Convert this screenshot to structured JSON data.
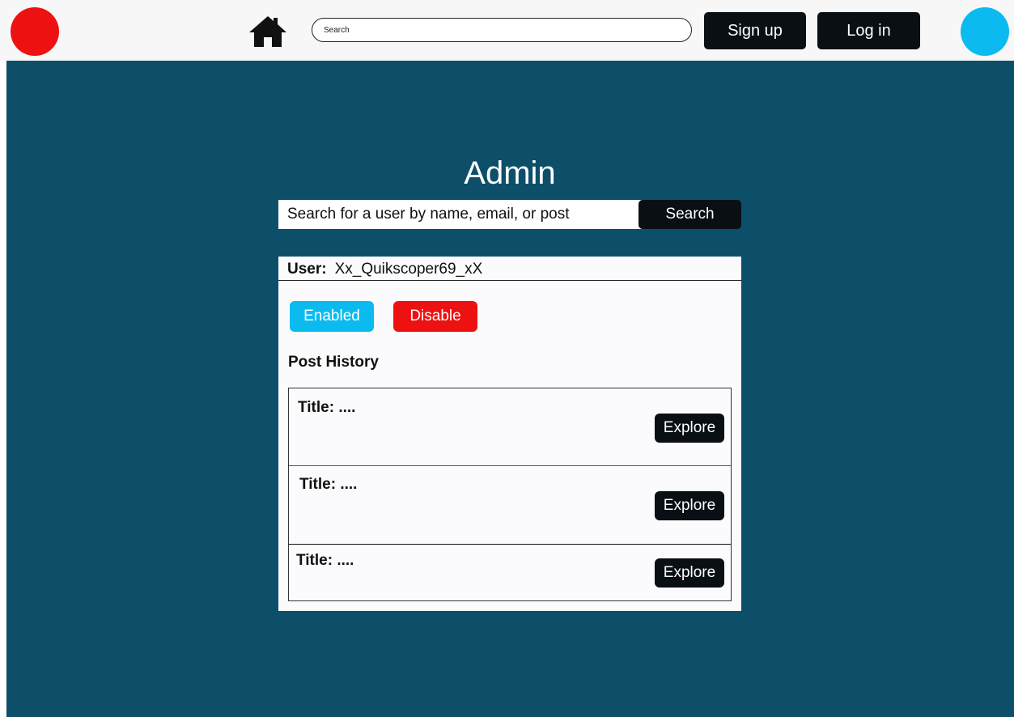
{
  "header": {
    "search_placeholder": "Search",
    "signup_label": "Sign up",
    "login_label": "Log in",
    "logo_color": "#ee1111",
    "avatar_color": "#0bbbf0",
    "home_icon": "home-icon"
  },
  "admin": {
    "title": "Admin",
    "search_placeholder": "Search for a user by name, email, or post",
    "search_button": "Search",
    "user_label": "User:",
    "username": "Xx_Quikscoper69_xX",
    "enabled_label": "Enabled",
    "disable_label": "Disable",
    "post_history_label": "Post History",
    "posts": [
      {
        "title": "Title: ....",
        "action": "Explore"
      },
      {
        "title": "Title: ....",
        "action": "Explore"
      },
      {
        "title": "Title: ....",
        "action": "Explore"
      }
    ]
  },
  "colors": {
    "main_background": "#0d4f69",
    "dark_button": "#0a0f14",
    "enabled": "#0bbbf0",
    "disable": "#ee1111"
  }
}
